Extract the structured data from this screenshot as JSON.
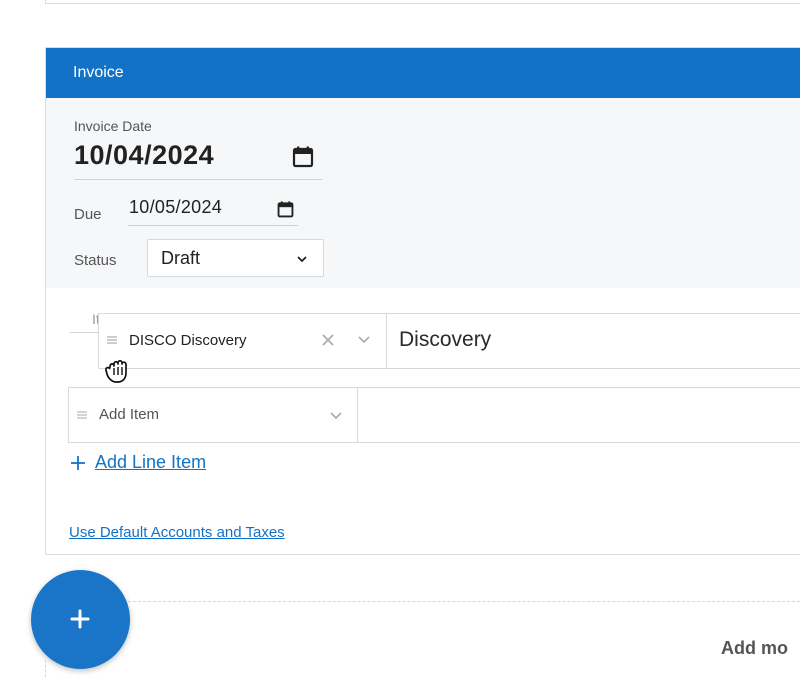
{
  "panel": {
    "title": "Invoice"
  },
  "invoice_date": {
    "label": "Invoice Date",
    "value": "10/04/2024"
  },
  "due_date": {
    "label": "Due",
    "value": "10/05/2024"
  },
  "status": {
    "label": "Status",
    "value": "Draft"
  },
  "line_items": {
    "header_stub": "It",
    "rows": [
      {
        "item": "DISCO Discovery",
        "description": "Discovery"
      }
    ],
    "add_item_placeholder": "Add Item",
    "add_line_label": "Add Line Item"
  },
  "links": {
    "default_accounts": "Use Default Accounts and Taxes"
  },
  "footer": {
    "add_more": "Add mo"
  },
  "colors": {
    "accent": "#1273c6",
    "fab": "#1a75c8",
    "panel_bg": "#f5f7f9"
  },
  "icons": {
    "calendar": "calendar-icon",
    "chevron": "chevron-down-icon",
    "drag": "drag-handle-icon",
    "clear": "close-icon",
    "plus": "plus-icon",
    "cursor": "grab-hand-cursor-icon"
  }
}
